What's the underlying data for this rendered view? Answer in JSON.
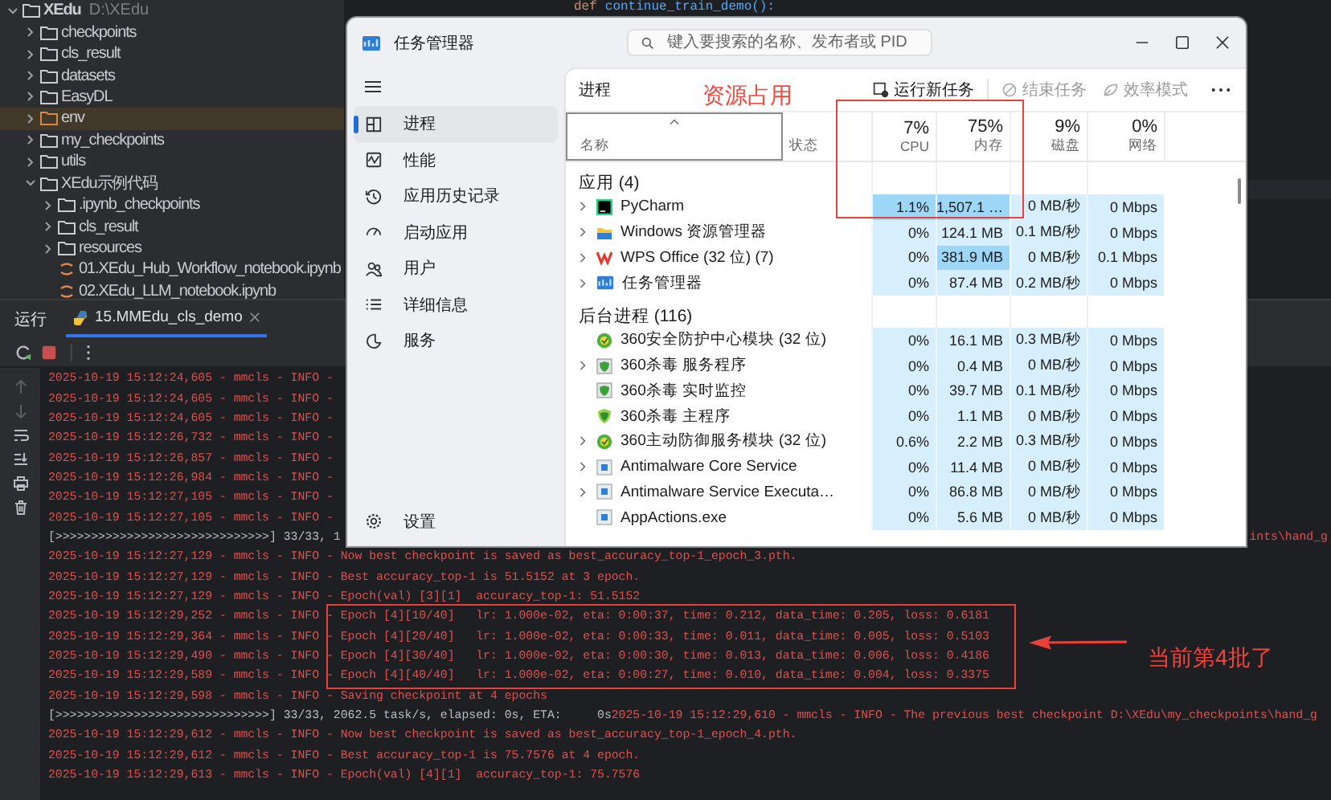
{
  "editor": {
    "keyword": "def",
    "code": "continue_train_demo():"
  },
  "project_tree": [
    {
      "name": "XEdu",
      "path": "D:\\XEdu",
      "kind": "folder",
      "expanded": true,
      "selected": false,
      "children": [
        {
          "name": "checkpoints",
          "kind": "folder",
          "expanded": false,
          "selected": false
        },
        {
          "name": "cls_result",
          "kind": "folder",
          "expanded": false,
          "selected": false
        },
        {
          "name": "datasets",
          "kind": "folder",
          "expanded": false,
          "selected": false
        },
        {
          "name": "EasyDL",
          "kind": "folder",
          "expanded": false,
          "selected": false
        },
        {
          "name": "env",
          "kind": "folder",
          "expanded": false,
          "selected": true
        },
        {
          "name": "my_checkpoints",
          "kind": "folder",
          "expanded": false,
          "selected": false
        },
        {
          "name": "utils",
          "kind": "folder",
          "expanded": false,
          "selected": false
        },
        {
          "name": "XEdu示例代码",
          "kind": "folder",
          "expanded": true,
          "selected": false,
          "children": [
            {
              "name": ".ipynb_checkpoints",
              "kind": "folder",
              "expanded": false,
              "selected": false
            },
            {
              "name": "cls_result",
              "kind": "folder",
              "expanded": false,
              "selected": false
            },
            {
              "name": "resources",
              "kind": "folder",
              "expanded": false,
              "selected": false
            },
            {
              "name": "01.XEdu_Hub_Workflow_notebook.ipynb",
              "kind": "file",
              "selected": false
            },
            {
              "name": "02.XEdu_LLM_notebook.ipynb",
              "kind": "file",
              "selected": false
            }
          ]
        }
      ]
    }
  ],
  "run_panel": {
    "title": "运行",
    "tabs": [
      {
        "label": "15.MMEdu_cls_demo",
        "selected": true
      }
    ],
    "log_lines": [
      {
        "kind": "stderr",
        "text": "2025-10-19 15:12:24,605 - mmcls - INFO -"
      },
      {
        "kind": "stderr",
        "text": "2025-10-19 15:12:24,605 - mmcls - INFO -"
      },
      {
        "kind": "stderr",
        "text": "2025-10-19 15:12:24,605 - mmcls - INFO -"
      },
      {
        "kind": "stderr",
        "text": "2025-10-19 15:12:26,732 - mmcls - INFO -"
      },
      {
        "kind": "stderr",
        "text": "2025-10-19 15:12:26,857 - mmcls - INFO -"
      },
      {
        "kind": "stderr",
        "text": "2025-10-19 15:12:26,984 - mmcls - INFO -"
      },
      {
        "kind": "stderr",
        "text": "2025-10-19 15:12:27,105 - mmcls - INFO -"
      },
      {
        "kind": "stderr",
        "text": "2025-10-19 15:12:27,105 - mmcls - INFO -"
      },
      {
        "kind": "stdout",
        "text": "[>>>>>>>>>>>>>>>>>>>>>>>>>>>>>>] 33/33, 1",
        "end_fragment": "ints\\hand_g"
      },
      {
        "kind": "stderr",
        "text": "2025-10-19 15:12:27,129 - mmcls - INFO - Now best checkpoint is saved as best_accuracy_top-1_epoch_3.pth."
      },
      {
        "kind": "stderr",
        "text": "2025-10-19 15:12:27,129 - mmcls - INFO - Best accuracy_top-1 is 51.5152 at 3 epoch."
      },
      {
        "kind": "stderr",
        "text": "2025-10-19 15:12:27,129 - mmcls - INFO - Epoch(val) [3][1]  accuracy_top-1: 51.5152"
      },
      {
        "kind": "stderr",
        "text": "2025-10-19 15:12:29,252 - mmcls - INFO - Epoch [4][10/40]   lr: 1.000e-02, eta: 0:00:37, time: 0.212, data_time: 0.205, loss: 0.6181"
      },
      {
        "kind": "stderr",
        "text": "2025-10-19 15:12:29,364 - mmcls - INFO - Epoch [4][20/40]   lr: 1.000e-02, eta: 0:00:33, time: 0.011, data_time: 0.005, loss: 0.5103"
      },
      {
        "kind": "stderr",
        "text": "2025-10-19 15:12:29,490 - mmcls - INFO - Epoch [4][30/40]   lr: 1.000e-02, eta: 0:00:30, time: 0.013, data_time: 0.006, loss: 0.4186"
      },
      {
        "kind": "stderr",
        "text": "2025-10-19 15:12:29,589 - mmcls - INFO - Epoch [4][40/40]   lr: 1.000e-02, eta: 0:00:27, time: 0.010, data_time: 0.004, loss: 0.3375"
      },
      {
        "kind": "stderr",
        "text": "2025-10-19 15:12:29,598 - mmcls - INFO - Saving checkpoint at 4 epochs"
      },
      {
        "kind": "stdout",
        "text": "[>>>>>>>>>>>>>>>>>>>>>>>>>>>>>>] 33/33, 2062.5 task/s, elapsed: 0s, ETA:     0s",
        "continuation": "2025-10-19 15:12:29,610 - mmcls - INFO - The previous best checkpoint D:\\XEdu\\my_checkpoints\\hand_g"
      },
      {
        "kind": "stderr",
        "text": "2025-10-19 15:12:29,612 - mmcls - INFO - Now best checkpoint is saved as best_accuracy_top-1_epoch_4.pth."
      },
      {
        "kind": "stderr",
        "text": "2025-10-19 15:12:29,612 - mmcls - INFO - Best accuracy_top-1 is 75.7576 at 4 epoch."
      },
      {
        "kind": "stderr",
        "text": "2025-10-19 15:12:29,613 - mmcls - INFO - Epoch(val) [4][1]  accuracy_top-1: 75.7576"
      }
    ]
  },
  "task_manager": {
    "title": "任务管理器",
    "search": {
      "placeholder": "键入要搜索的名称、发布者或 PID"
    },
    "nav": [
      {
        "label": "进程",
        "selected": true
      },
      {
        "label": "性能",
        "selected": false
      },
      {
        "label": "应用历史记录",
        "selected": false
      },
      {
        "label": "启动应用",
        "selected": false
      },
      {
        "label": "用户",
        "selected": false
      },
      {
        "label": "详细信息",
        "selected": false
      },
      {
        "label": "服务",
        "selected": false
      }
    ],
    "settings": "设置",
    "page_title": "进程",
    "toolbar": [
      {
        "label": "运行新任务",
        "disabled": false
      },
      {
        "label": "结束任务",
        "disabled": true
      },
      {
        "label": "效率模式",
        "disabled": true
      }
    ],
    "columns": [
      {
        "label": "名称"
      },
      {
        "label": "状态"
      },
      {
        "label": "CPU",
        "total": "7%"
      },
      {
        "label": "内存",
        "total": "75%"
      },
      {
        "label": "磁盘",
        "total": "9%"
      },
      {
        "label": "网络",
        "total": "0%"
      }
    ],
    "groups": [
      {
        "title": "应用 (4)",
        "rows": [
          {
            "name": "PyCharm",
            "kind": "ide",
            "expandable": true,
            "cells": [
              {
                "text": "1.1%",
                "hot": true
              },
              {
                "text": "1,507.1 …",
                "hot": true
              },
              {
                "text": "0 MB/秒",
                "hot": false
              },
              {
                "text": "0 Mbps",
                "hot": false
              }
            ]
          },
          {
            "name": "Windows 资源管理器",
            "kind": "folder",
            "expandable": true,
            "cells": [
              {
                "text": "0%",
                "hot": false
              },
              {
                "text": "124.1 MB",
                "hot": false
              },
              {
                "text": "0.1 MB/秒",
                "hot": false
              },
              {
                "text": "0 Mbps",
                "hot": false
              }
            ]
          },
          {
            "name": "WPS Office (32 位) (7)",
            "kind": "zigzag",
            "expandable": true,
            "cells": [
              {
                "text": "0%",
                "hot": false
              },
              {
                "text": "381.9 MB",
                "hot": true
              },
              {
                "text": "0 MB/秒",
                "hot": false
              },
              {
                "text": "0.1 Mbps",
                "hot": false
              }
            ]
          },
          {
            "name": "任务管理器",
            "kind": "monitor",
            "expandable": true,
            "cells": [
              {
                "text": "0%",
                "hot": false
              },
              {
                "text": "87.4 MB",
                "hot": false
              },
              {
                "text": "0.2 MB/秒",
                "hot": false
              },
              {
                "text": "0 Mbps",
                "hot": false
              }
            ]
          }
        ]
      },
      {
        "title": "后台进程 (116)",
        "rows": [
          {
            "name": "360安全防护中心模块 (32 位)",
            "kind": "orb",
            "expandable": false,
            "cells": [
              {
                "text": "0%",
                "hot": false
              },
              {
                "text": "16.1 MB",
                "hot": false
              },
              {
                "text": "0.3 MB/秒",
                "hot": false
              },
              {
                "text": "0 Mbps",
                "hot": false
              }
            ]
          },
          {
            "name": "360杀毒 服务程序",
            "kind": "boxed-shield",
            "expandable": true,
            "cells": [
              {
                "text": "0%",
                "hot": false
              },
              {
                "text": "0.4 MB",
                "hot": false
              },
              {
                "text": "0 MB/秒",
                "hot": false
              },
              {
                "text": "0 Mbps",
                "hot": false
              }
            ]
          },
          {
            "name": "360杀毒 实时监控",
            "kind": "boxed-shield",
            "expandable": false,
            "cells": [
              {
                "text": "0%",
                "hot": false
              },
              {
                "text": "39.7 MB",
                "hot": false
              },
              {
                "text": "0.1 MB/秒",
                "hot": false
              },
              {
                "text": "0 Mbps",
                "hot": false
              }
            ]
          },
          {
            "name": "360杀毒 主程序",
            "kind": "shield",
            "expandable": false,
            "cells": [
              {
                "text": "0%",
                "hot": false
              },
              {
                "text": "1.1 MB",
                "hot": false
              },
              {
                "text": "0 MB/秒",
                "hot": false
              },
              {
                "text": "0 Mbps",
                "hot": false
              }
            ]
          },
          {
            "name": "360主动防御服务模块 (32 位)",
            "kind": "orb",
            "expandable": true,
            "cells": [
              {
                "text": "0.6%",
                "hot": false
              },
              {
                "text": "2.2 MB",
                "hot": false
              },
              {
                "text": "0.3 MB/秒",
                "hot": false
              },
              {
                "text": "0 Mbps",
                "hot": false
              }
            ]
          },
          {
            "name": "Antimalware Core Service",
            "kind": "window",
            "expandable": true,
            "cells": [
              {
                "text": "0%",
                "hot": false
              },
              {
                "text": "11.4 MB",
                "hot": false
              },
              {
                "text": "0 MB/秒",
                "hot": false
              },
              {
                "text": "0 Mbps",
                "hot": false
              }
            ]
          },
          {
            "name": "Antimalware Service Executa…",
            "kind": "window",
            "expandable": true,
            "cells": [
              {
                "text": "0%",
                "hot": false
              },
              {
                "text": "86.8 MB",
                "hot": false
              },
              {
                "text": "0 MB/秒",
                "hot": false
              },
              {
                "text": "0 Mbps",
                "hot": false
              }
            ]
          },
          {
            "name": "AppActions.exe",
            "kind": "window",
            "expandable": false,
            "cells": [
              {
                "text": "0%",
                "hot": false
              },
              {
                "text": "5.6 MB",
                "hot": false
              },
              {
                "text": "0 MB/秒",
                "hot": false
              },
              {
                "text": "0 Mbps",
                "hot": false
              }
            ]
          }
        ]
      }
    ]
  },
  "annotations": [
    {
      "text": "资源占用"
    },
    {
      "text": "当前第4批了"
    }
  ]
}
